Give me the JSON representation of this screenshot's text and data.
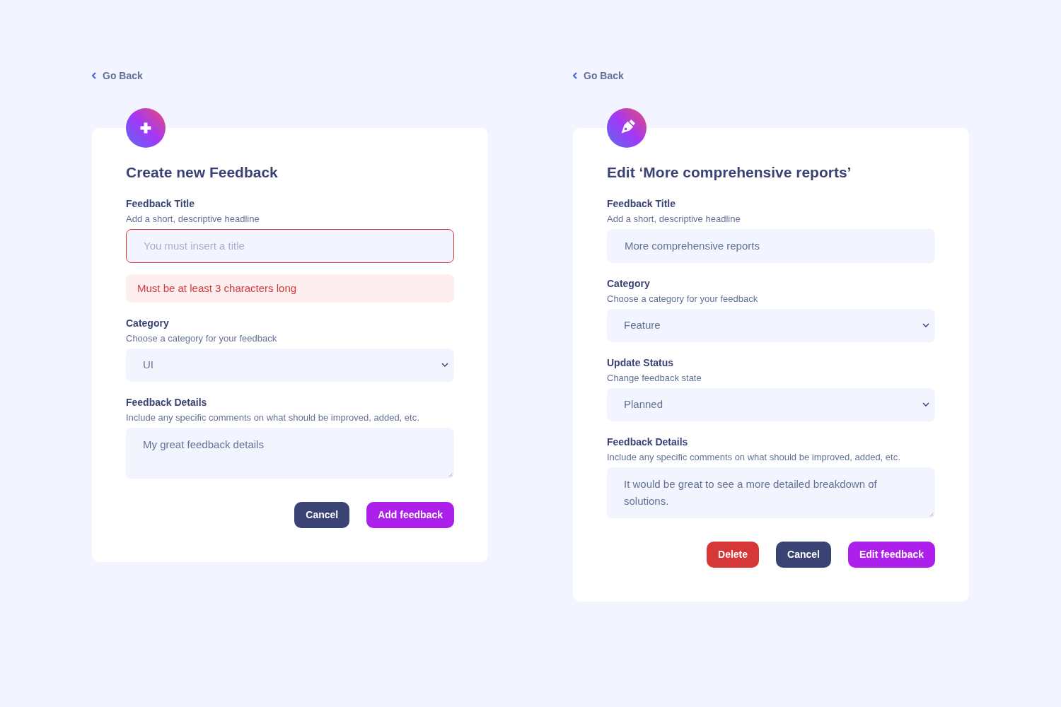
{
  "panels": [
    {
      "kind": "create",
      "go_back": "Go Back",
      "title": "Create new Feedback",
      "fields": [
        {
          "kind": "text",
          "label": "Feedback Title",
          "description": "Add a short, descriptive headline",
          "placeholder": "You must insert a title",
          "invalid": true,
          "error": "Must be at least 3 characters long"
        },
        {
          "kind": "select",
          "label": "Category",
          "description": "Choose a category for your feedback",
          "value": "UI"
        },
        {
          "kind": "textarea",
          "label": "Feedback Details",
          "description": "Include any specific comments on what should be improved, added, etc.",
          "value": "My great feedback details"
        }
      ],
      "buttons": [
        {
          "kind": "secondary",
          "label": "Cancel"
        },
        {
          "kind": "primary",
          "label": "Add feedback"
        }
      ]
    },
    {
      "kind": "edit",
      "go_back": "Go Back",
      "title": "Edit ‘More comprehensive reports’",
      "fields": [
        {
          "kind": "text",
          "label": "Feedback Title",
          "description": "Add a short, descriptive headline",
          "value": "More comprehensive reports",
          "invalid": false
        },
        {
          "kind": "select",
          "label": "Category",
          "description": "Choose a category for your feedback",
          "value": "Feature"
        },
        {
          "kind": "select",
          "label": "Update Status",
          "description": "Change feedback state",
          "value": "Planned"
        },
        {
          "kind": "textarea",
          "label": "Feedback Details",
          "description": "Include any specific comments on what should be improved, added, etc.",
          "value": "It would be great to see a more detailed breakdown of solutions."
        }
      ],
      "buttons": [
        {
          "kind": "danger",
          "label": "Delete"
        },
        {
          "kind": "secondary",
          "label": "Cancel"
        },
        {
          "kind": "primary",
          "label": "Edit feedback"
        }
      ]
    }
  ]
}
